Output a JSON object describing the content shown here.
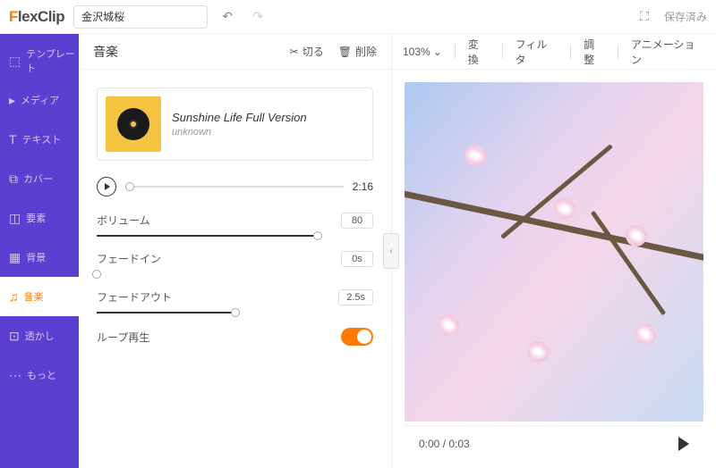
{
  "brand": {
    "f": "F",
    "rest": "lexClip"
  },
  "search": {
    "value": "金沢城桜"
  },
  "topbar": {
    "save": "保存済み"
  },
  "sidebar": {
    "items": [
      {
        "label": "テンプレート",
        "icon": "⬚"
      },
      {
        "label": "メディア",
        "icon": "▸"
      },
      {
        "label": "テキスト",
        "icon": "T"
      },
      {
        "label": "カバー",
        "icon": "⧉"
      },
      {
        "label": "要素",
        "icon": "◫"
      },
      {
        "label": "背景",
        "icon": "▦"
      },
      {
        "label": "音楽",
        "icon": "♫"
      },
      {
        "label": "透かし",
        "icon": "⊡"
      },
      {
        "label": "もっと",
        "icon": "⋯"
      }
    ]
  },
  "panel": {
    "title": "音楽",
    "cut": "切る",
    "delete": "削除"
  },
  "track": {
    "title": "Sunshine Life Full Version",
    "artist": "unknown",
    "duration": "2:16"
  },
  "controls": {
    "volume": {
      "label": "ボリューム",
      "value": "80",
      "pct": 80
    },
    "fadein": {
      "label": "フェードイン",
      "value": "0s",
      "pct": 0
    },
    "fadeout": {
      "label": "フェードアウト",
      "value": "2.5s",
      "pct": 50
    },
    "loop": {
      "label": "ループ再生"
    }
  },
  "preview": {
    "zoom": "103%",
    "tabs": [
      "変換",
      "フィルタ",
      "調整",
      "アニメーション"
    ],
    "time": "0:00 / 0:03"
  }
}
